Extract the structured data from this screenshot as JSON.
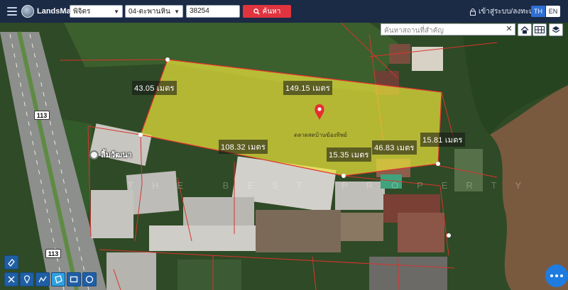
{
  "header": {
    "brand": "LandsMaps",
    "province_select": "พิจิตร",
    "district_select": "04-ตะพานหิน",
    "parcel_number": "38254",
    "search_label": "ค้นหา",
    "login_label": "เข้าสู่ระบบ/ลงทะเบียน",
    "lang_th": "TH",
    "lang_en": "EN"
  },
  "map": {
    "place_search_placeholder": "ค้นหาสถานที่สำคัญ",
    "edge_labels": [
      "43.05 เมตร",
      "149.15 เมตร",
      "108.32 เมตร",
      "15.35 เมตร",
      "46.83 เมตร",
      "15.81 เมตร"
    ],
    "poi_name": "ลิ้มวัฒนา",
    "pin_label": "ตลาดสดบ้านฆ้องทิพย์",
    "road_shield": "113",
    "watermark": "THE BEST PROPERTY",
    "parcel_fill": "#e8e23a",
    "parcel_stroke": "#e3302f"
  }
}
